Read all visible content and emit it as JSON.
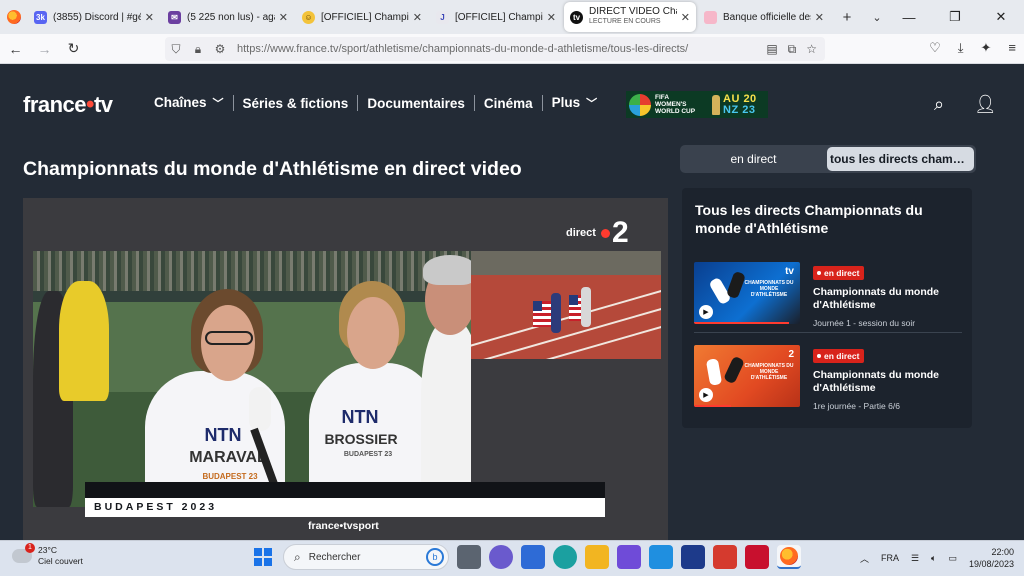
{
  "browser": {
    "tabs": [
      {
        "title": "(3855) Discord | #géné",
        "favicon_color": "#5865f2",
        "favicon_text": "3k"
      },
      {
        "title": "(5 225 non lus) - agard",
        "favicon_color": "#6b3fa0",
        "favicon_text": ""
      },
      {
        "title": "[OFFICIEL] Championn",
        "favicon_color": "#f3c33a",
        "favicon_text": ""
      },
      {
        "title": "[OFFICIEL] Championn",
        "favicon_color": "#e8e8ee",
        "favicon_text": "J"
      },
      {
        "title": "DIRECT VIDEO Champ",
        "subtitle": "LECTURE EN COURS",
        "favicon_color": "#111111",
        "favicon_text": "tv",
        "active": true
      },
      {
        "title": "Banque officielle des n",
        "favicon_color": "#e8407a",
        "favicon_text": ""
      }
    ],
    "new_tab_label": "+",
    "url": "https://www.france.tv/sport/athletisme/championnats-du-monde-d-athletisme/tous-les-directs/"
  },
  "site": {
    "logo_left": "france",
    "logo_dot": "•",
    "logo_right": "tv",
    "menu": [
      {
        "label": "Chaînes",
        "dropdown": true
      },
      {
        "label": "Séries & fictions",
        "dropdown": false
      },
      {
        "label": "Documentaires",
        "dropdown": false
      },
      {
        "label": "Cinéma",
        "dropdown": false
      },
      {
        "label": "Plus",
        "dropdown": true
      }
    ],
    "promo": {
      "line1": "FIFA",
      "line2": "WOMEN'S",
      "line3": "WORLD CUP",
      "anz_top": "AU 20",
      "anz_bottom": "NZ 23"
    }
  },
  "page": {
    "title": "Championnats du monde d'Athlétisme en direct video",
    "toggle": {
      "options": [
        "en direct",
        "tous les directs champi..."
      ],
      "selected_index": 1
    }
  },
  "player": {
    "channel_prefix": "direct",
    "channel_number": "2",
    "lower_third": "BUDAPEST 2023",
    "watermark": "france•tvsport",
    "bib_1_sponsor": "NTN",
    "bib_1_name": "MARAVAL",
    "bib_1_event": "BUDAPEST 23",
    "bib_2_sponsor": "NTN",
    "bib_2_name": "BROSSIER",
    "bib_2_event": "BUDAPEST 23"
  },
  "sidebar": {
    "heading": "Tous les directs Championnats du monde d'Athlétisme",
    "items": [
      {
        "badge": "en direct",
        "title": "Championnats du monde d'Athlétisme",
        "subtitle": "Journée 1 - session du soir",
        "thumb_text": "CHAMPIONNATS DU MONDE D'ATHLÉTISME",
        "thumb_logo": "tv",
        "thumb_color": "#0d6fd1",
        "progress": 0.9
      },
      {
        "badge": "en direct",
        "title": "Championnats du monde d'Athlétisme",
        "subtitle": "1re journée - Partie 6/6",
        "thumb_text": "CHAMPIONNATS DU MONDE D'ATHLÉTISME",
        "thumb_logo": "2",
        "thumb_color": "#e8522a",
        "progress": 0.35
      }
    ]
  },
  "taskbar": {
    "weather_temp": "23°C",
    "weather_desc": "Ciel couvert",
    "weather_badge": "1",
    "search_placeholder": "Rechercher",
    "lang": "FRA",
    "time": "22:00",
    "date": "19/08/2023"
  },
  "colors": {
    "page_bg": "#232b36",
    "accent_red": "#ff3b2f",
    "badge_red": "#d8231b"
  }
}
